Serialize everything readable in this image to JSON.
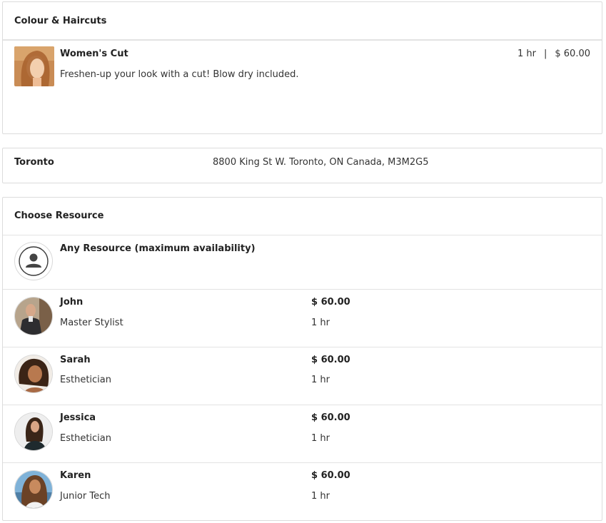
{
  "service_section": {
    "heading": "Colour & Haircuts",
    "service": {
      "title": "Women's Cut",
      "description": "Freshen-up your look with a cut! Blow dry included.",
      "duration": "1 hr",
      "separator": "|",
      "price": "$ 60.00"
    }
  },
  "location": {
    "name": "Toronto",
    "address": "8800 King St W. Toronto, ON Canada, M3M2G5"
  },
  "resource_section": {
    "heading": "Choose Resource",
    "any_resource_label": "Any Resource (maximum availability)",
    "resources": [
      {
        "name": "John",
        "role": "Master Stylist",
        "price": "$ 60.00",
        "duration": "1 hr"
      },
      {
        "name": "Sarah",
        "role": "Esthetician",
        "price": "$ 60.00",
        "duration": "1 hr"
      },
      {
        "name": "Jessica",
        "role": "Esthetician",
        "price": "$ 60.00",
        "duration": "1 hr"
      },
      {
        "name": "Karen",
        "role": "Junior Tech",
        "price": "$ 60.00",
        "duration": "1 hr"
      }
    ]
  },
  "icons": {
    "any_resource": "user-icon"
  },
  "colors": {
    "border": "#dcdcdc",
    "text": "#2b2b2b"
  }
}
